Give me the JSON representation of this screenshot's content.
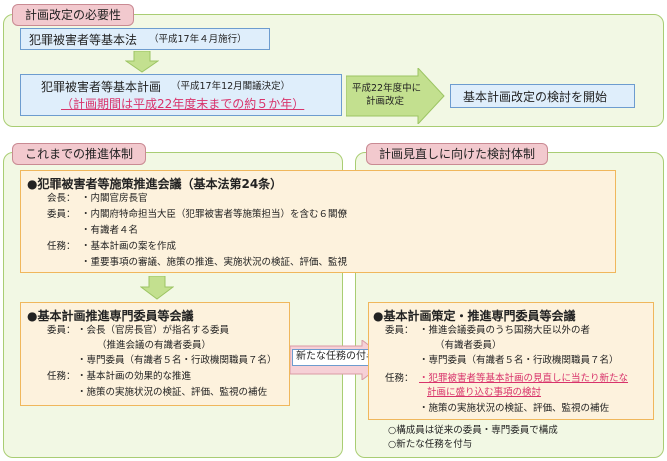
{
  "section1": {
    "tab": "計画改定の必要性",
    "law": "犯罪被害者等基本法",
    "law_note": "（平成17年４月施行）",
    "plan": "犯罪被害者等基本計画",
    "plan_note": "（平成17年12月閣議決定）",
    "plan_period": "（計画期間は平成22年度末までの約５か年）",
    "arrow_line1": "平成22年度中に",
    "arrow_line2": "計画改定",
    "result": "基本計画改定の検討を開始"
  },
  "left": {
    "tab": "これまでの推進体制",
    "council": {
      "title": "●犯罪被害者等施策推進会議（基本法第24条）",
      "chair_label": "会長：",
      "chair_value": "・内閣官房長官",
      "members_label": "委員：",
      "members_1": "・内閣府特命担当大臣（犯罪被害者等施策担当）を含む６閣僚",
      "members_2": "・有識者４名",
      "duty_label": "任務：",
      "duty_1": "・基本計画の案を作成",
      "duty_2": "・重要事項の審議、施策の推進、実施状況の検証、評価、監視"
    },
    "committee": {
      "title": "●基本計画推進専門委員等会議",
      "members_label": "委員：",
      "members_1": "・会長（官房長官）が指名する委員",
      "members_1b": "（推進会議の有識者委員）",
      "members_2": "・専門委員（有識者５名・行政機関職員７名）",
      "duty_label": "任務：",
      "duty_1": "・基本計画の効果的な推進",
      "duty_2": "・施策の実施状況の検証、評価、監視の補佐"
    }
  },
  "middle_arrow": "新たな任務の付与",
  "right": {
    "tab": "計画見直しに向けた検討体制",
    "committee": {
      "title": "●基本計画策定・推進専門委員等会議",
      "members_label": "委員：",
      "members_1": "・推進会議委員のうち国務大臣以外の者",
      "members_1b": "（有識者委員）",
      "members_2": "・専門委員（有識者５名・行政機関職員７名）",
      "duty_label": "任務：",
      "duty_1a": "・犯罪被害者等基本計画の見直しに当たり新たな",
      "duty_1b": "計画に盛り込む事項の検討",
      "duty_2": "・施策の実施状況の検証、評価、監視の補佐"
    },
    "note_1": "○構成員は従来の委員・専門委員で構成",
    "note_2": "○新たな任務を付与"
  },
  "colors": {
    "accent_red": "#d8336b",
    "green_frame": "#a9cd73",
    "blue_box": "#dfeefb",
    "orange_border": "#f0b75c"
  }
}
